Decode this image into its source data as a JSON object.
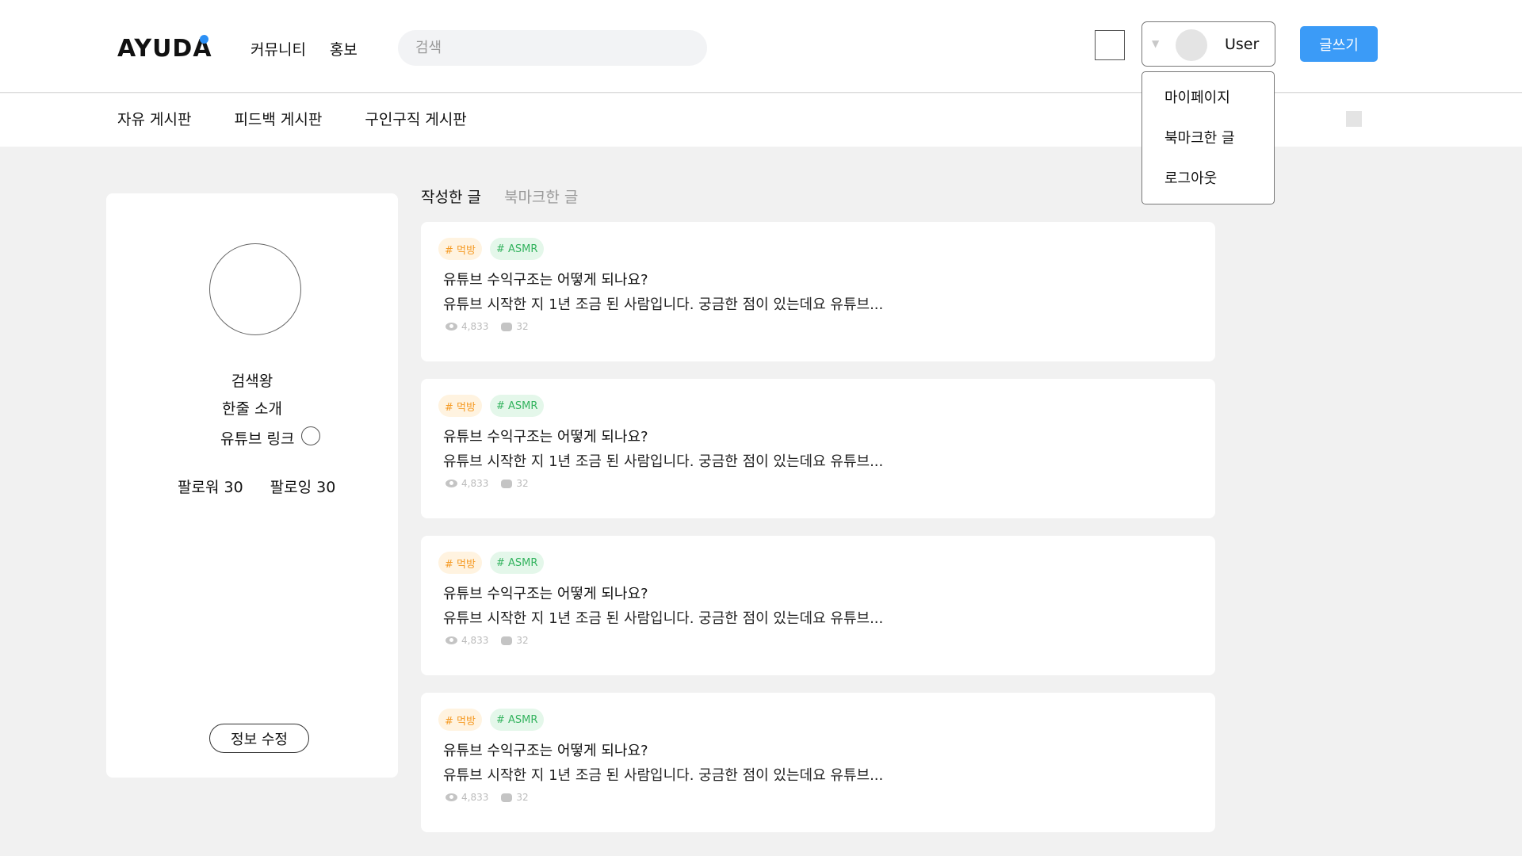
{
  "header": {
    "logo": "AYUDA",
    "nav": [
      "커뮤니티",
      "홍보"
    ],
    "search_placeholder": "검색",
    "user_name": "User",
    "write_label": "글쓰기",
    "accent": "#3b9bf7"
  },
  "dropdown": {
    "items": [
      "마이페이지",
      "북마크한 글",
      "로그아웃"
    ]
  },
  "subnav": {
    "items": [
      "자유 게시판",
      "피드백 게시판",
      "구인구직 게시판"
    ]
  },
  "profile": {
    "name": "검색왕",
    "intro": "한줄 소개",
    "link_label": "유튜브 링크",
    "followers": "팔로워 30",
    "following": "팔로잉 30",
    "edit_label": "정보 수정"
  },
  "tabs": {
    "written": "작성한 글",
    "bookmarked": "북마크한 글"
  },
  "posts": [
    {
      "tag1": "# 먹방",
      "tag2": "# ASMR",
      "title": "유튜브 수익구조는 어떻게 되나요?",
      "body": "유튜브 시작한 지 1년 조금 된 사람입니다. 궁금한 점이 있는데요 유튜브...",
      "views": "4,833",
      "comments": "32"
    },
    {
      "tag1": "# 먹방",
      "tag2": "# ASMR",
      "title": "유튜브 수익구조는 어떻게 되나요?",
      "body": "유튜브 시작한 지 1년 조금 된 사람입니다. 궁금한 점이 있는데요 유튜브...",
      "views": "4,833",
      "comments": "32"
    },
    {
      "tag1": "# 먹방",
      "tag2": "# ASMR",
      "title": "유튜브 수익구조는 어떻게 되나요?",
      "body": "유튜브 시작한 지 1년 조금 된 사람입니다. 궁금한 점이 있는데요 유튜브...",
      "views": "4,833",
      "comments": "32"
    },
    {
      "tag1": "# 먹방",
      "tag2": "# ASMR",
      "title": "유튜브 수익구조는 어떻게 되나요?",
      "body": "유튜브 시작한 지 1년 조금 된 사람입니다. 궁금한 점이 있는데요 유튜브...",
      "views": "4,833",
      "comments": "32"
    }
  ]
}
